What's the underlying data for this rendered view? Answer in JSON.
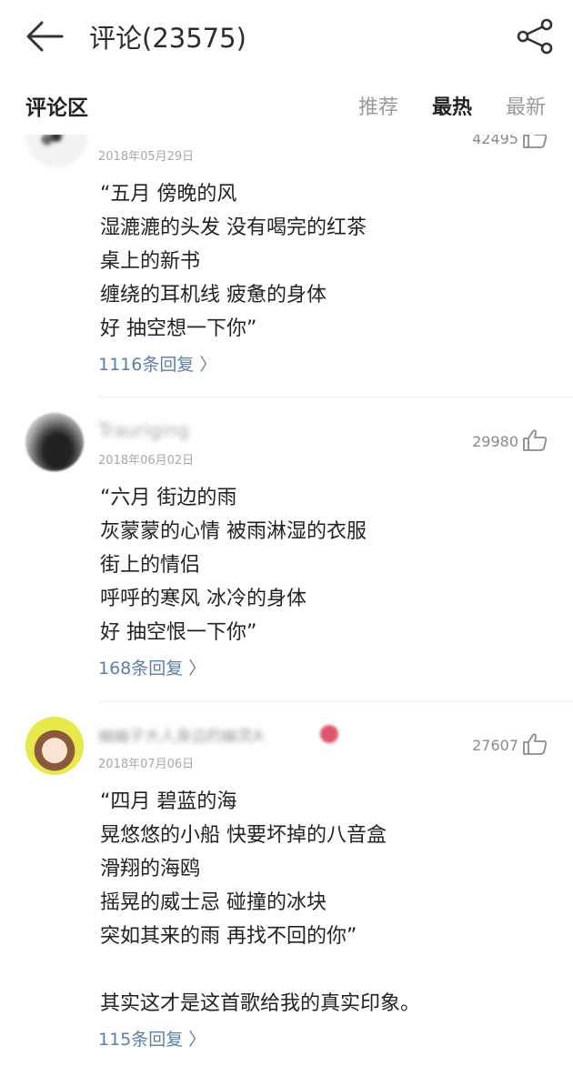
{
  "header": {
    "title": "评论(23575)",
    "back_icon": "arrow-left-icon",
    "share_icon": "share-icon"
  },
  "section": {
    "title": "评论区",
    "tabs": [
      {
        "label": "推荐",
        "active": false
      },
      {
        "label": "最热",
        "active": true
      },
      {
        "label": "最新",
        "active": false
      }
    ]
  },
  "comments": [
    {
      "username": "",
      "date": "2018年05月29日",
      "likes": "42495",
      "lines": [
        "“五月 傍晚的风",
        "湿漉漉的头发 没有喝完的红茶",
        "桌上的新书",
        "缠绕的耳机线 疲惫的身体",
        "好 抽空想一下你”"
      ],
      "reply": "1116条回复 〉"
    },
    {
      "username": "Trauriging",
      "date": "2018年06月02日",
      "likes": "29980",
      "lines": [
        "“六月 街边的雨",
        "灰蒙蒙的心情 被雨淋湿的衣服",
        "街上的情侣",
        "呼呼的寒风 冰冷的身体",
        "好 抽空恨一下你”"
      ],
      "reply": "168条回复 〉"
    },
    {
      "username": "幽幽子大人身边的幽灵A",
      "date": "2018年07月06日",
      "likes": "27607",
      "lines": [
        "“四月 碧蓝的海",
        "晃悠悠的小船 快要坏掉的八音盒",
        "滑翔的海鸥",
        "摇晃的威士忌 碰撞的冰块",
        "突如其来的雨 再找不回的你”",
        "",
        "其实这才是这首歌给我的真实印象。"
      ],
      "reply": "115条回复 〉"
    }
  ],
  "colors": {
    "reply_link": "#5e7ea6",
    "tab_inactive": "#999999",
    "text": "#222222"
  }
}
